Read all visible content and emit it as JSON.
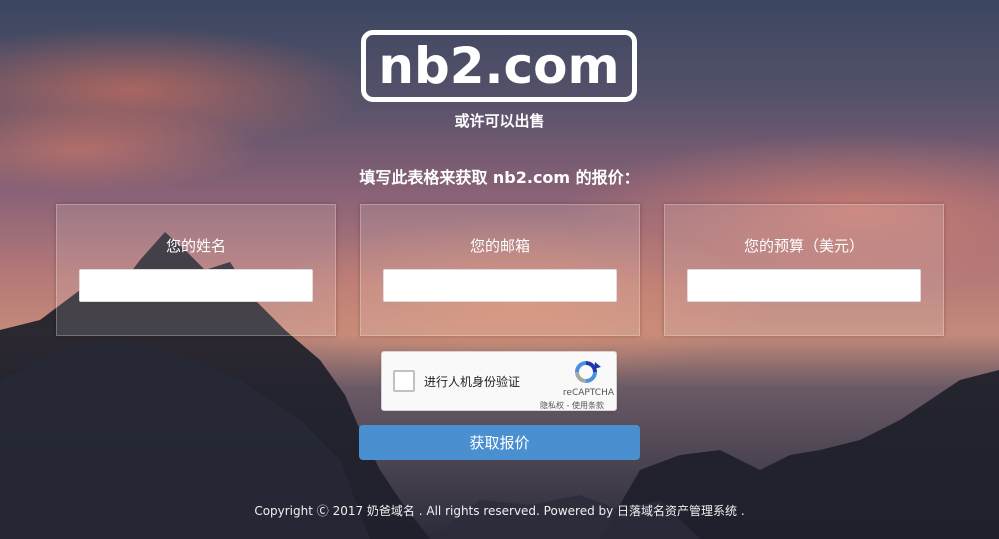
{
  "logo": {
    "text": "nb2.com"
  },
  "subtitle": "或许可以出售",
  "prompt": "填写此表格来获取 nb2.com 的报价：",
  "fields": {
    "name": {
      "label": "您的姓名",
      "value": ""
    },
    "email": {
      "label": "您的邮箱",
      "value": ""
    },
    "budget": {
      "label": "您的预算（美元）",
      "value": ""
    }
  },
  "captcha": {
    "label": "进行人机身份验证",
    "brand": "reCAPTCHA",
    "links": "隐私权 - 使用条款"
  },
  "submit_label": "获取报价",
  "footer": "Copyright Ⓒ 2017 奶爸域名 . All rights reserved. Powered by 日落域名资产管理系统 .",
  "colors": {
    "accent": "#4a90d0",
    "text": "#ffffff"
  },
  "icons": {
    "captcha": "recaptcha-icon"
  }
}
